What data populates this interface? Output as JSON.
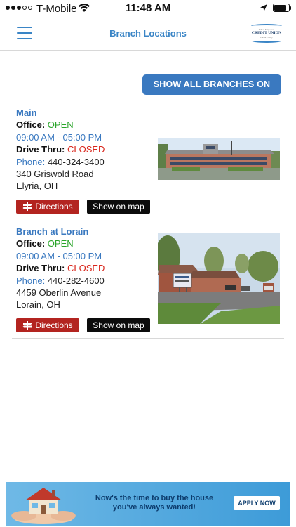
{
  "status_bar": {
    "carrier": "T-Mobile",
    "time": "11:48 AM",
    "battery_level": 0.85
  },
  "nav": {
    "title": "Branch Locations",
    "logo_text_small": "Lorain County",
    "logo_text_main": "CREDIT UNION",
    "logo_text_top": "School Employees"
  },
  "show_all_label": "SHOW ALL BRANCHES ON MAP",
  "branches": [
    {
      "name": "Main",
      "office_label": "Office:",
      "office_status": "OPEN",
      "hours": "09:00 AM - 05:00 PM",
      "drive_label": "Drive Thru:",
      "drive_status": "CLOSED",
      "phone_label": "Phone:",
      "phone": "440-324-3400",
      "address1": "340 Griswold Road",
      "address2": "Elyria, OH",
      "directions_label": "Directions",
      "map_label": "Show on map"
    },
    {
      "name": "Branch at Lorain",
      "office_label": "Office:",
      "office_status": "OPEN",
      "hours": "09:00 AM - 05:00 PM",
      "drive_label": "Drive Thru:",
      "drive_status": "CLOSED",
      "phone_label": "Phone:",
      "phone": "440-282-4600",
      "address1": "4459 Oberlin Avenue",
      "address2": "Lorain, OH",
      "directions_label": "Directions",
      "map_label": "Show on map"
    }
  ],
  "ad": {
    "line1": "Now's the time to buy the house",
    "line2": "you've always wanted!",
    "cta": "APPLY NOW"
  },
  "colors": {
    "accent": "#3a79c0",
    "open": "#2aa52a",
    "closed": "#d9261c",
    "directions": "#b32420"
  }
}
